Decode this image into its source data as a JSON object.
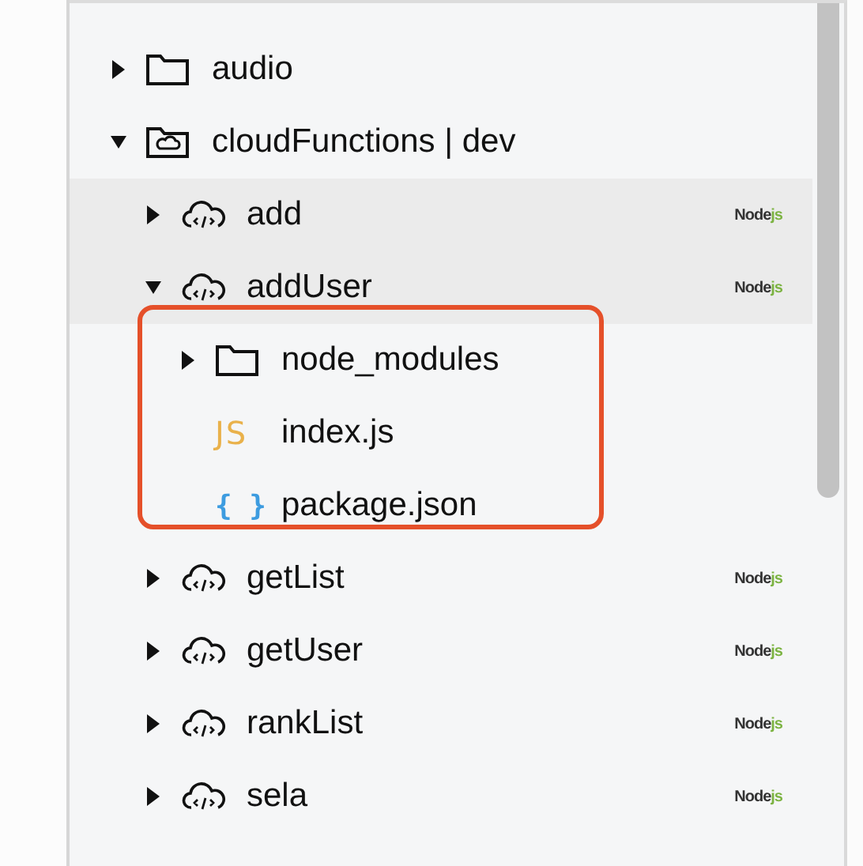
{
  "tree": [
    {
      "name": "audio",
      "kind": "folder",
      "expanded": false,
      "highlighted": false
    },
    {
      "name": "cloudFunctions | dev",
      "kind": "cloud-folder",
      "expanded": true,
      "highlighted": false,
      "children": [
        {
          "name": "add",
          "kind": "cloud-function",
          "expanded": false,
          "highlighted": true,
          "badge": {
            "prefix": "Node",
            "suffix": "js"
          }
        },
        {
          "name": "addUser",
          "kind": "cloud-function",
          "expanded": true,
          "highlighted": true,
          "annotated": true,
          "badge": {
            "prefix": "Node",
            "suffix": "js"
          },
          "children": [
            {
              "name": "node_modules",
              "kind": "folder",
              "expanded": false,
              "highlighted": false
            },
            {
              "name": "index.js",
              "kind": "js",
              "icon_text": "JS",
              "highlighted": false
            },
            {
              "name": "package.json",
              "kind": "json",
              "icon_text": "{ }",
              "highlighted": false
            }
          ]
        },
        {
          "name": "getList",
          "kind": "cloud-function",
          "expanded": false,
          "highlighted": false,
          "badge": {
            "prefix": "Node",
            "suffix": "js"
          }
        },
        {
          "name": "getUser",
          "kind": "cloud-function",
          "expanded": false,
          "highlighted": false,
          "badge": {
            "prefix": "Node",
            "suffix": "js"
          }
        },
        {
          "name": "rankList",
          "kind": "cloud-function",
          "expanded": false,
          "highlighted": false,
          "badge": {
            "prefix": "Node",
            "suffix": "js"
          }
        },
        {
          "name": "sela",
          "kind": "cloud-function",
          "expanded": false,
          "highlighted": false,
          "badge": {
            "prefix": "Node",
            "suffix": "js"
          }
        }
      ]
    }
  ]
}
